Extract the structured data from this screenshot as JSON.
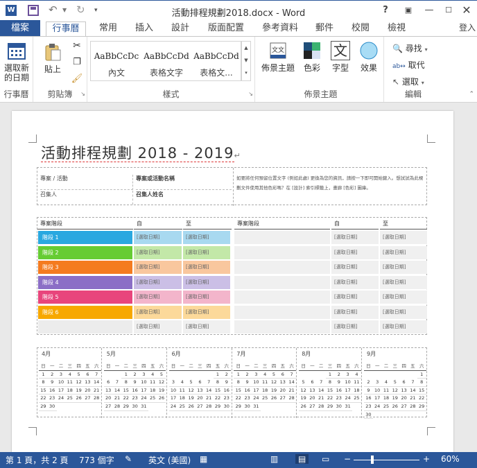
{
  "window": {
    "title": "活動排程規劃2018.docx - Word",
    "word_logo": "W",
    "help": "?",
    "signin": "登入"
  },
  "tabs": {
    "file": "檔案",
    "items": [
      "行事曆",
      "常用",
      "插入",
      "設計",
      "版面配置",
      "參考資料",
      "郵件",
      "校閱",
      "檢視"
    ]
  },
  "ribbon": {
    "calendar_group": {
      "button": "選取新的日期",
      "label": "行事曆"
    },
    "clipboard_group": {
      "paste": "貼上",
      "label": "剪貼簿"
    },
    "styles_group": {
      "label": "樣式",
      "items": [
        {
          "sample": "AaBbCcDc",
          "name": "內文"
        },
        {
          "sample": "AaBbCcDd",
          "name": "表格文字"
        },
        {
          "sample": "AaBbCcDd",
          "name": "表格文..."
        }
      ]
    },
    "theme_group": {
      "label": "佈景主題",
      "themes": "佈景主題",
      "colors": "色彩",
      "fonts": "字型",
      "effects": "效果",
      "fonts_icon_text": "文"
    },
    "editing_group": {
      "label": "編輯",
      "find": "尋找",
      "replace": "取代",
      "select": "選取"
    }
  },
  "document": {
    "heading": "活動排程規劃 2018 - 2019",
    "info": {
      "project_label": "專案 / 活動",
      "project_value": "專案或活動名稱",
      "convener_label": "召集人",
      "convener_value": "召集人姓名",
      "note": "如要將任何預留位置文字 (例如此處) 更換為您的資訊，請按一下即可開始鍵入。想試試為此規劃文件使用其他色彩嗎？在 [設計] 索引標籤上，畫廊 [色彩] 圖庫。"
    },
    "phase_headers": [
      "專案階段",
      "自",
      "至",
      "專案階段",
      "自",
      "至"
    ],
    "phases": [
      {
        "name": "階段 1",
        "color": "#29a8e0"
      },
      {
        "name": "階段 2",
        "color": "#66cc33"
      },
      {
        "name": "階段 3",
        "color": "#f47b20"
      },
      {
        "name": "階段 4",
        "color": "#8b6ec6"
      },
      {
        "name": "階段 5",
        "color": "#e8457c"
      },
      {
        "name": "階段 6",
        "color": "#f7a800"
      },
      {
        "name": "",
        "color": "#ececec"
      }
    ],
    "phase_tints": [
      "#a8d9f0",
      "#c3e8a8",
      "#f9c79e",
      "#cbbfe6",
      "#f3b5cb",
      "#fcd99a",
      "#f0f0f0"
    ],
    "date_placeholder": "[選取日期]",
    "calendar": {
      "dow": [
        "日",
        "一",
        "二",
        "三",
        "四",
        "五",
        "六"
      ],
      "months": [
        {
          "name": "4月",
          "start": 0,
          "days": 30
        },
        {
          "name": "5月",
          "start": 2,
          "days": 31
        },
        {
          "name": "6月",
          "start": 5,
          "days": 30
        },
        {
          "name": "7月",
          "start": 0,
          "days": 31
        },
        {
          "name": "8月",
          "start": 3,
          "days": 31
        },
        {
          "name": "9月",
          "start": 6,
          "days": 30
        }
      ]
    }
  },
  "statusbar": {
    "page": "第 1 頁，共 2 頁",
    "words": "773 個字",
    "lang": "英文 (美國)",
    "zoom": "60%",
    "zoom_pct": 60
  }
}
